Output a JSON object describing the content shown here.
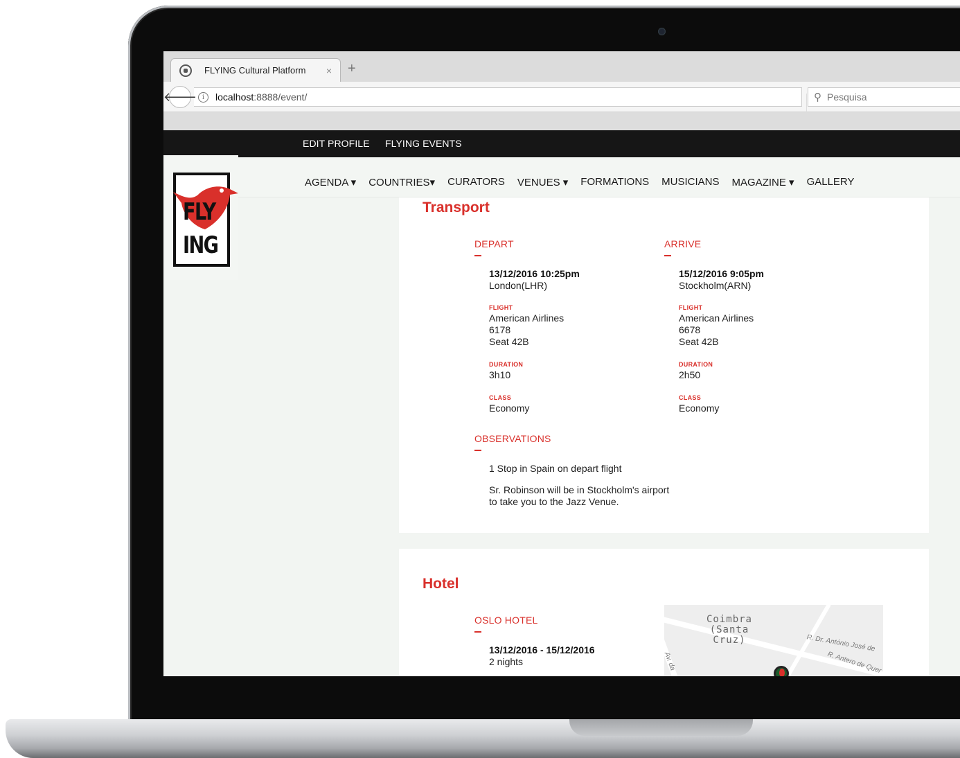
{
  "browser": {
    "tab_title": "FLYING Cultural Platform",
    "tab_close": "×",
    "new_tab": "+",
    "url_host": "localhost",
    "url_path": ":8888/event/",
    "search_placeholder": "Pesquisa"
  },
  "topbar": {
    "edit_profile": "EDIT PROFILE",
    "flying_events": "FLYING EVENTS"
  },
  "logo": {
    "line1": "FLY",
    "line2": "ING"
  },
  "nav": [
    {
      "label": "AGENDA ▾"
    },
    {
      "label": "COUNTRIES▾"
    },
    {
      "label": "CURATORS"
    },
    {
      "label": "VENUES ▾"
    },
    {
      "label": "FORMATIONS"
    },
    {
      "label": "MUSICIANS"
    },
    {
      "label": "MAGAZINE ▾"
    },
    {
      "label": "GALLERY"
    }
  ],
  "transport": {
    "title": "Transport",
    "depart": {
      "heading": "DEPART",
      "datetime": "13/12/2016 10:25pm",
      "place": "London(LHR)",
      "flight_label": "FLIGHT",
      "airline": "American Airlines",
      "flight_no": "6178",
      "seat": "Seat 42B",
      "duration_label": "DURATION",
      "duration": "3h10",
      "class_label": "CLASS",
      "class": "Economy"
    },
    "arrive": {
      "heading": "ARRIVE",
      "datetime": "15/12/2016 9:05pm",
      "place": "Stockholm(ARN)",
      "flight_label": "FLIGHT",
      "airline": "American Airlines",
      "flight_no": "6678",
      "seat": "Seat 42B",
      "duration_label": "DURATION",
      "duration": "2h50",
      "class_label": "CLASS",
      "class": "Economy"
    },
    "observations": {
      "heading": "OBSERVATIONS",
      "line1": "1 Stop in Spain on depart flight",
      "line2a": "Sr. Robinson will be in Stockholm's airport",
      "line2b": "to take you to the Jazz Venue."
    }
  },
  "hotel": {
    "title": "Hotel",
    "name": "OSLO HOTEL",
    "dates": "13/12/2016 - 15/12/2016",
    "nights": "2 nights",
    "map": {
      "place_line1": "Coimbra",
      "place_line2": "(Santa Cruz)",
      "street1": "R. Dr. António José de",
      "street2": "R. Antero de Quer",
      "street3": "Av. da"
    }
  }
}
